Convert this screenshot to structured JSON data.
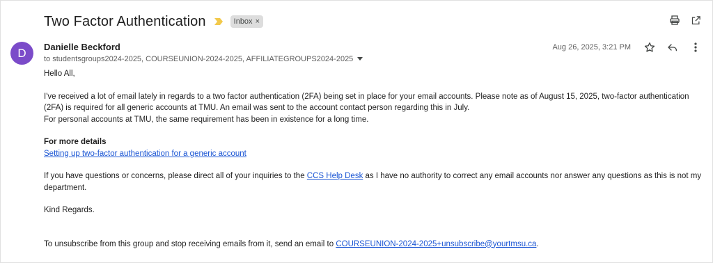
{
  "email": {
    "subject": "Two Factor Authentication",
    "label_chip": "Inbox",
    "chip_remove": "×",
    "sender_initial": "D",
    "sender_name": "Danielle Beckford",
    "recipients": "to studentsgroups2024-2025, COURSEUNION-2024-2025, AFFILIATEGROUPS2024-2025",
    "date": "Aug 26, 2025, 3:21 PM",
    "icons": {
      "print": "print-icon",
      "open_new_window": "open-in-new-window-icon",
      "star": "star-icon",
      "reply": "reply-icon",
      "more": "more-vertical-icon",
      "importance": "importance-marker-icon",
      "recipients_caret": "caret-down-icon"
    },
    "colors": {
      "avatar": "#7b4bc9",
      "link": "#1a55d4",
      "importance": "#f2c94c",
      "chip_bg": "#dddddd"
    },
    "body": {
      "greeting": "Hello All,",
      "para1_line1": "I've received a lot of email lately in regards to a two factor authentication (2FA) being set in place for your email accounts. Please note as of August 15, 2025, two-factor authentication (2FA) is required for all generic accounts at TMU. An email was sent to the account contact person regarding this in July.",
      "para1_line2": "For personal accounts at TMU, the same requirement has been in existence for a long time.",
      "details_heading": "For more details",
      "details_link": "Setting up two-factor authentication for a generic account",
      "para2_before": "If you have questions or concerns, please direct all of your inquiries to the ",
      "para2_link": "CCS Help Desk",
      "para2_after": " as I have no authority to correct any email accounts nor answer any questions as this is not my department.",
      "signoff": "Kind Regards.",
      "unsub_before": "To unsubscribe from this group and stop receiving emails from it, send an email to ",
      "unsub_link": "COURSEUNION-2024-2025+unsubscribe@yourtmsu.ca",
      "unsub_after": "."
    }
  }
}
